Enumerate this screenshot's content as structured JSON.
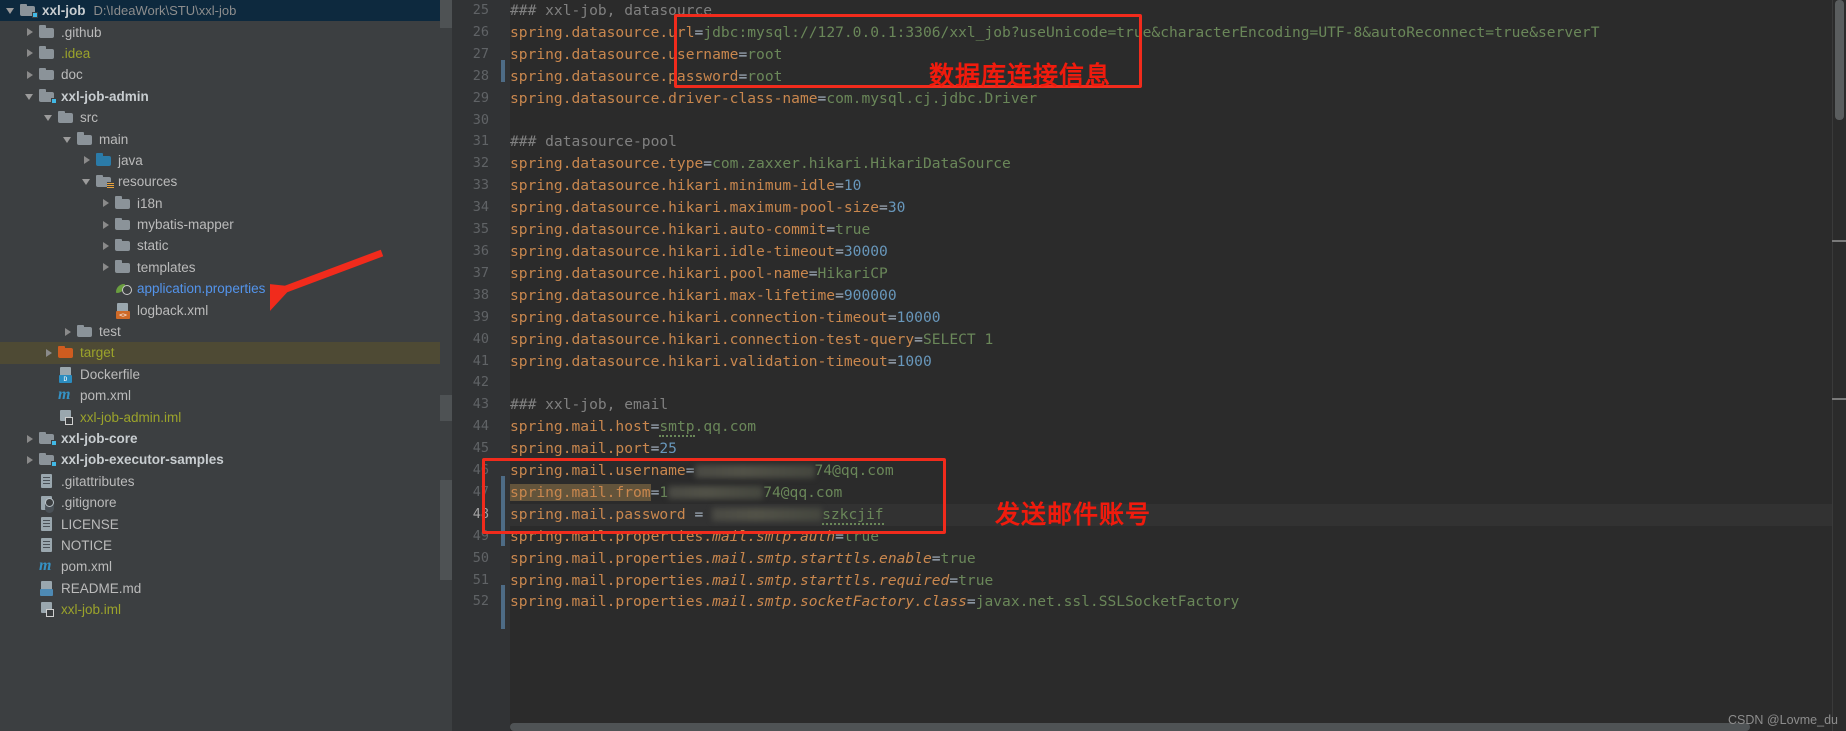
{
  "project": {
    "name": "xxl-job",
    "path": "D:\\IdeaWork\\STU\\xxl-job"
  },
  "tree": [
    {
      "label": "xxl-job",
      "hint": "D:\\IdeaWork\\STU\\xxl-job",
      "icon": "module-folder",
      "arrow": "down",
      "indent": 0,
      "style": "bold",
      "selected": "blue"
    },
    {
      "label": ".github",
      "hint": "",
      "icon": "folder",
      "arrow": "right",
      "indent": 1,
      "style": "plain",
      "selected": "none"
    },
    {
      "label": ".idea",
      "hint": "",
      "icon": "folder",
      "arrow": "right",
      "indent": 1,
      "style": "olive",
      "selected": "none"
    },
    {
      "label": "doc",
      "hint": "",
      "icon": "folder",
      "arrow": "right",
      "indent": 1,
      "style": "plain",
      "selected": "none"
    },
    {
      "label": "xxl-job-admin",
      "hint": "",
      "icon": "module-folder",
      "arrow": "down",
      "indent": 1,
      "style": "bold",
      "selected": "none"
    },
    {
      "label": "src",
      "hint": "",
      "icon": "folder",
      "arrow": "down",
      "indent": 2,
      "style": "plain",
      "selected": "none"
    },
    {
      "label": "main",
      "hint": "",
      "icon": "folder",
      "arrow": "down",
      "indent": 3,
      "style": "plain",
      "selected": "none"
    },
    {
      "label": "java",
      "hint": "",
      "icon": "folder-blue",
      "arrow": "right",
      "indent": 4,
      "style": "plain",
      "selected": "none"
    },
    {
      "label": "resources",
      "hint": "",
      "icon": "folder-res",
      "arrow": "down",
      "indent": 4,
      "style": "plain",
      "selected": "none"
    },
    {
      "label": "i18n",
      "hint": "",
      "icon": "folder",
      "arrow": "right",
      "indent": 5,
      "style": "plain",
      "selected": "none"
    },
    {
      "label": "mybatis-mapper",
      "hint": "",
      "icon": "folder",
      "arrow": "right",
      "indent": 5,
      "style": "plain",
      "selected": "none"
    },
    {
      "label": "static",
      "hint": "",
      "icon": "folder",
      "arrow": "right",
      "indent": 5,
      "style": "plain",
      "selected": "none"
    },
    {
      "label": "templates",
      "hint": "",
      "icon": "folder",
      "arrow": "right",
      "indent": 5,
      "style": "plain",
      "selected": "none"
    },
    {
      "label": "application.properties",
      "hint": "",
      "icon": "spring-leaf",
      "arrow": "none",
      "indent": 5,
      "style": "blue",
      "selected": "none"
    },
    {
      "label": "logback.xml",
      "hint": "",
      "icon": "xml-file",
      "arrow": "none",
      "indent": 5,
      "style": "plain",
      "selected": "none"
    },
    {
      "label": "test",
      "hint": "",
      "icon": "folder",
      "arrow": "right",
      "indent": 3,
      "style": "plain",
      "selected": "none"
    },
    {
      "label": "target",
      "hint": "",
      "icon": "folder-orange",
      "arrow": "right",
      "indent": 2,
      "style": "olive",
      "selected": "olive"
    },
    {
      "label": "Dockerfile",
      "hint": "",
      "icon": "docker-file",
      "arrow": "none",
      "indent": 2,
      "style": "plain",
      "selected": "none"
    },
    {
      "label": "pom.xml",
      "hint": "",
      "icon": "maven-file",
      "arrow": "none",
      "indent": 2,
      "style": "plain",
      "selected": "none"
    },
    {
      "label": "xxl-job-admin.iml",
      "hint": "",
      "icon": "iml-file",
      "arrow": "none",
      "indent": 2,
      "style": "olive",
      "selected": "none"
    },
    {
      "label": "xxl-job-core",
      "hint": "",
      "icon": "module-folder",
      "arrow": "right",
      "indent": 1,
      "style": "bold",
      "selected": "none"
    },
    {
      "label": "xxl-job-executor-samples",
      "hint": "",
      "icon": "module-folder",
      "arrow": "right",
      "indent": 1,
      "style": "bold",
      "selected": "none"
    },
    {
      "label": ".gitattributes",
      "hint": "",
      "icon": "text-file",
      "arrow": "none",
      "indent": 1,
      "style": "plain",
      "selected": "none"
    },
    {
      "label": ".gitignore",
      "hint": "",
      "icon": "gitignore-file",
      "arrow": "none",
      "indent": 1,
      "style": "plain",
      "selected": "none"
    },
    {
      "label": "LICENSE",
      "hint": "",
      "icon": "text-file",
      "arrow": "none",
      "indent": 1,
      "style": "plain",
      "selected": "none"
    },
    {
      "label": "NOTICE",
      "hint": "",
      "icon": "text-file",
      "arrow": "none",
      "indent": 1,
      "style": "plain",
      "selected": "none"
    },
    {
      "label": "pom.xml",
      "hint": "",
      "icon": "maven-file",
      "arrow": "none",
      "indent": 1,
      "style": "plain",
      "selected": "none"
    },
    {
      "label": "README.md",
      "hint": "",
      "icon": "md-file",
      "arrow": "none",
      "indent": 1,
      "style": "plain",
      "selected": "none"
    },
    {
      "label": "xxl-job.iml",
      "hint": "",
      "icon": "iml-file",
      "arrow": "none",
      "indent": 1,
      "style": "olive",
      "selected": "none"
    }
  ],
  "editor": {
    "file": "application.properties",
    "first_line_number": 25,
    "lines": [
      {
        "no": 25,
        "current": false,
        "tokens": [
          {
            "t": "c",
            "s": "### xxl-job, datasource"
          }
        ]
      },
      {
        "no": 26,
        "current": false,
        "tokens": [
          {
            "t": "k",
            "s": "spring.datasource.url"
          },
          {
            "t": "eq",
            "s": "="
          },
          {
            "t": "v",
            "s": "jdbc:mysql://127.0.0.1:3306/xxl_job?useUnicode=true&characterEncoding=UTF-8&autoReconnect=true&serverT"
          }
        ]
      },
      {
        "no": 27,
        "current": false,
        "tokens": [
          {
            "t": "k",
            "s": "spring.datasource.username"
          },
          {
            "t": "eq",
            "s": "="
          },
          {
            "t": "v",
            "s": "root"
          }
        ]
      },
      {
        "no": 28,
        "current": false,
        "tokens": [
          {
            "t": "k",
            "s": "spring.datasource.password"
          },
          {
            "t": "eq",
            "s": "="
          },
          {
            "t": "v",
            "s": "root"
          }
        ]
      },
      {
        "no": 29,
        "current": false,
        "tokens": [
          {
            "t": "k",
            "s": "spring.datasource.driver-class-name"
          },
          {
            "t": "eq",
            "s": "="
          },
          {
            "t": "v",
            "s": "com.mysql.cj.jdbc.Driver"
          }
        ]
      },
      {
        "no": 30,
        "current": false,
        "tokens": []
      },
      {
        "no": 31,
        "current": false,
        "tokens": [
          {
            "t": "c",
            "s": "### datasource-pool"
          }
        ]
      },
      {
        "no": 32,
        "current": false,
        "tokens": [
          {
            "t": "k",
            "s": "spring.datasource.type"
          },
          {
            "t": "eq",
            "s": "="
          },
          {
            "t": "v",
            "s": "com.zaxxer.hikari.HikariDataSource"
          }
        ]
      },
      {
        "no": 33,
        "current": false,
        "tokens": [
          {
            "t": "k",
            "s": "spring.datasource.hikari.minimum-idle"
          },
          {
            "t": "eq",
            "s": "="
          },
          {
            "t": "n",
            "s": "10"
          }
        ]
      },
      {
        "no": 34,
        "current": false,
        "tokens": [
          {
            "t": "k",
            "s": "spring.datasource.hikari.maximum-pool-size"
          },
          {
            "t": "eq",
            "s": "="
          },
          {
            "t": "n",
            "s": "30"
          }
        ]
      },
      {
        "no": 35,
        "current": false,
        "tokens": [
          {
            "t": "k",
            "s": "spring.datasource.hikari.auto-commit"
          },
          {
            "t": "eq",
            "s": "="
          },
          {
            "t": "v",
            "s": "true"
          }
        ]
      },
      {
        "no": 36,
        "current": false,
        "tokens": [
          {
            "t": "k",
            "s": "spring.datasource.hikari.idle-timeout"
          },
          {
            "t": "eq",
            "s": "="
          },
          {
            "t": "n",
            "s": "30000"
          }
        ]
      },
      {
        "no": 37,
        "current": false,
        "tokens": [
          {
            "t": "k",
            "s": "spring.datasource.hikari.pool-name"
          },
          {
            "t": "eq",
            "s": "="
          },
          {
            "t": "v",
            "s": "HikariCP"
          }
        ]
      },
      {
        "no": 38,
        "current": false,
        "tokens": [
          {
            "t": "k",
            "s": "spring.datasource.hikari.max-lifetime"
          },
          {
            "t": "eq",
            "s": "="
          },
          {
            "t": "n",
            "s": "900000"
          }
        ]
      },
      {
        "no": 39,
        "current": false,
        "tokens": [
          {
            "t": "k",
            "s": "spring.datasource.hikari.connection-timeout"
          },
          {
            "t": "eq",
            "s": "="
          },
          {
            "t": "n",
            "s": "10000"
          }
        ]
      },
      {
        "no": 40,
        "current": false,
        "tokens": [
          {
            "t": "k",
            "s": "spring.datasource.hikari.connection-test-query"
          },
          {
            "t": "eq",
            "s": "="
          },
          {
            "t": "v",
            "s": "SELECT 1"
          }
        ]
      },
      {
        "no": 41,
        "current": false,
        "tokens": [
          {
            "t": "k",
            "s": "spring.datasource.hikari.validation-timeout"
          },
          {
            "t": "eq",
            "s": "="
          },
          {
            "t": "n",
            "s": "1000"
          }
        ]
      },
      {
        "no": 42,
        "current": false,
        "tokens": []
      },
      {
        "no": 43,
        "current": false,
        "tokens": [
          {
            "t": "c",
            "s": "### xxl-job, email"
          }
        ]
      },
      {
        "no": 44,
        "current": false,
        "tokens": [
          {
            "t": "k",
            "s": "spring.mail.host"
          },
          {
            "t": "eq",
            "s": "="
          },
          {
            "t": "v squig",
            "s": "smtp"
          },
          {
            "t": "v",
            "s": ".qq.com"
          }
        ]
      },
      {
        "no": 45,
        "current": false,
        "tokens": [
          {
            "t": "k",
            "s": "spring.mail.port"
          },
          {
            "t": "eq",
            "s": "="
          },
          {
            "t": "n",
            "s": "25"
          }
        ]
      },
      {
        "no": 46,
        "current": false,
        "tokens": [
          {
            "t": "k",
            "s": "spring.mail.username"
          },
          {
            "t": "eq",
            "s": "="
          },
          {
            "t": "blur",
            "s": "120"
          },
          {
            "t": "v",
            "s": "74@qq.com"
          }
        ]
      },
      {
        "no": 47,
        "current": false,
        "tokens": [
          {
            "t": "k hl-ident",
            "s": "spring.mail.from"
          },
          {
            "t": "eq",
            "s": "="
          },
          {
            "t": "v",
            "s": "1"
          },
          {
            "t": "blur",
            "s": "95"
          },
          {
            "t": "v",
            "s": "74@qq.com"
          }
        ]
      },
      {
        "no": 48,
        "current": true,
        "tokens": [
          {
            "t": "k",
            "s": "spring.mail.password "
          },
          {
            "t": "eq",
            "s": "= "
          },
          {
            "t": "blur",
            "s": "110"
          },
          {
            "t": "v squig",
            "s": "szkcjif"
          }
        ]
      },
      {
        "no": 49,
        "current": false,
        "tokens": [
          {
            "t": "k",
            "s": "spring.mail.properties."
          },
          {
            "t": "k it",
            "s": "mail.smtp.auth"
          },
          {
            "t": "eq",
            "s": "="
          },
          {
            "t": "v",
            "s": "true"
          }
        ]
      },
      {
        "no": 50,
        "current": false,
        "tokens": [
          {
            "t": "k",
            "s": "spring.mail.properties."
          },
          {
            "t": "k it",
            "s": "mail.smtp.starttls.enable"
          },
          {
            "t": "eq",
            "s": "="
          },
          {
            "t": "v",
            "s": "true"
          }
        ]
      },
      {
        "no": 51,
        "current": false,
        "tokens": [
          {
            "t": "k",
            "s": "spring.mail.properties."
          },
          {
            "t": "k it",
            "s": "mail.smtp.starttls.required"
          },
          {
            "t": "eq",
            "s": "="
          },
          {
            "t": "v",
            "s": "true"
          }
        ]
      },
      {
        "no": 52,
        "current": false,
        "tokens": [
          {
            "t": "k",
            "s": "spring.mail.properties."
          },
          {
            "t": "k it",
            "s": "mail.smtp.socketFactory.class"
          },
          {
            "t": "eq",
            "s": "="
          },
          {
            "t": "v",
            "s": "javax.net.ssl.SSLSocketFactory"
          }
        ]
      }
    ]
  },
  "annotations": [
    {
      "id": "db-note",
      "text": "数据库连接信息",
      "color": "#f01b0d"
    },
    {
      "id": "email-note",
      "text": "发送邮件账号",
      "color": "#f01b0d"
    }
  ],
  "watermark": "CSDN @Lovme_du",
  "colors": {
    "accent_red": "#f12b1c",
    "sidebar_bg": "#3c3f41",
    "editor_bg": "#2b2b2b",
    "gutter_bg": "#313335",
    "key": "#c9874e",
    "value": "#6a8759",
    "number": "#6897bb",
    "comment": "#808080",
    "selection_olive": "#4e4a34",
    "selection_blue": "#0d293e"
  }
}
